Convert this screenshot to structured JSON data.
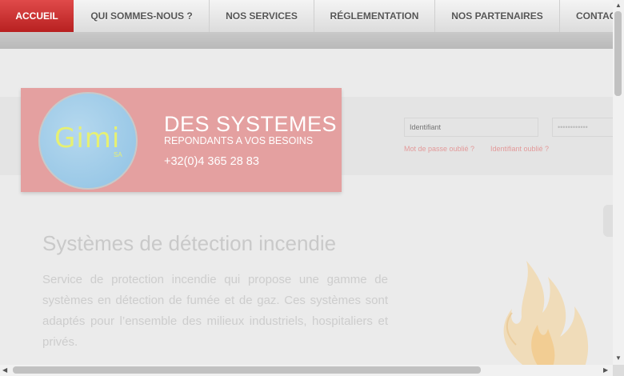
{
  "nav": {
    "items": [
      {
        "label": "ACCUEIL",
        "active": true
      },
      {
        "label": "QUI SOMMES-NOUS ?",
        "active": false
      },
      {
        "label": "NOS SERVICES",
        "active": false
      },
      {
        "label": "RÉGLEMENTATION",
        "active": false
      },
      {
        "label": "NOS PARTENAIRES",
        "active": false
      },
      {
        "label": "CONTACT",
        "active": false
      }
    ]
  },
  "banner": {
    "logo_text": "Gimi",
    "logo_sub": "SA",
    "tagline_main": "DES SYSTEMES",
    "tagline_sub": "REPONDANTS A VOS BESOINS",
    "phone": "+32(0)4 365 28 83"
  },
  "login": {
    "username_placeholder": "Identifiant",
    "password_value": "••••••••••••",
    "forgot_password": "Mot de passe oublié ?",
    "forgot_username": "Identifiant oublié ?"
  },
  "content": {
    "headline": "Systèmes de détection incendie",
    "description": "Service de protection incendie qui propose une gamme de systèmes en détection de fumée et de gaz. Ces systèmes sont adaptés pour l’ensemble des milieux industriels, hospitaliers et privés."
  },
  "colors": {
    "accent": "#c62828",
    "banner": "#e4a0a0"
  }
}
